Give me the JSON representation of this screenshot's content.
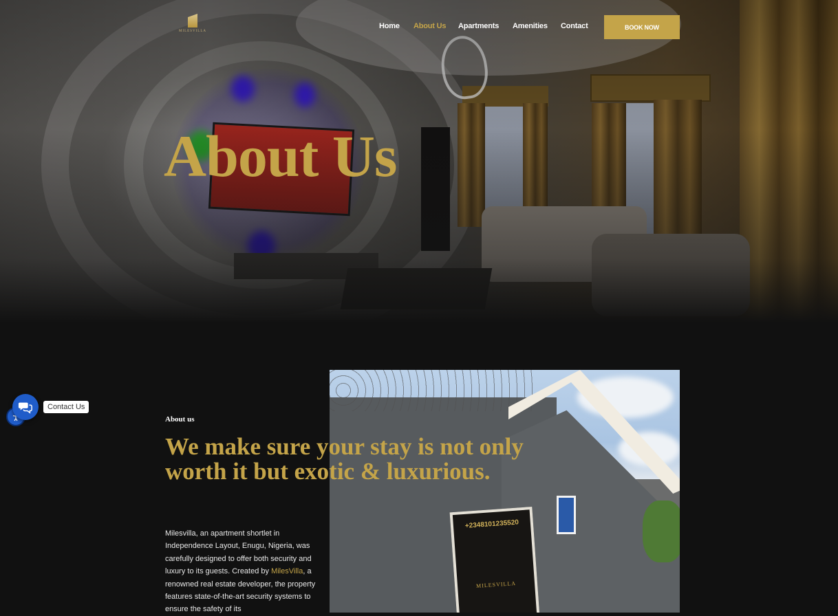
{
  "brand": {
    "logo_text": "MILESVILLA"
  },
  "nav": {
    "items": [
      "Home",
      "About Us",
      "Apartments",
      "Amenities",
      "Contact"
    ],
    "active": "About Us",
    "cta": "BOOK NOW"
  },
  "hero": {
    "title": "About Us"
  },
  "about": {
    "eyebrow": "About us",
    "heading": "We make sure your stay is not only worth it but exotic & luxurious.",
    "text_before": "Milesvilla, an apartment shortlet in Independence Layout, Enugu, Nigeria, was carefully designed to offer both security and luxury to its guests. Created by ",
    "text_link": "MilesVilla",
    "text_after": ", a renowned real estate developer, the property features state-of-the-art security systems to ensure the safety of its"
  },
  "photo_sign": {
    "phone": "+2348101235520",
    "name": "MILESVILLA"
  },
  "widget": {
    "chat_label": "Contact Us"
  },
  "colors": {
    "gold": "#c4a449",
    "background": "#111111",
    "widget_blue": "#1f5cc9"
  },
  "icons": {
    "chat": "chat-bubbles-icon",
    "accessibility": "accessibility-icon"
  }
}
